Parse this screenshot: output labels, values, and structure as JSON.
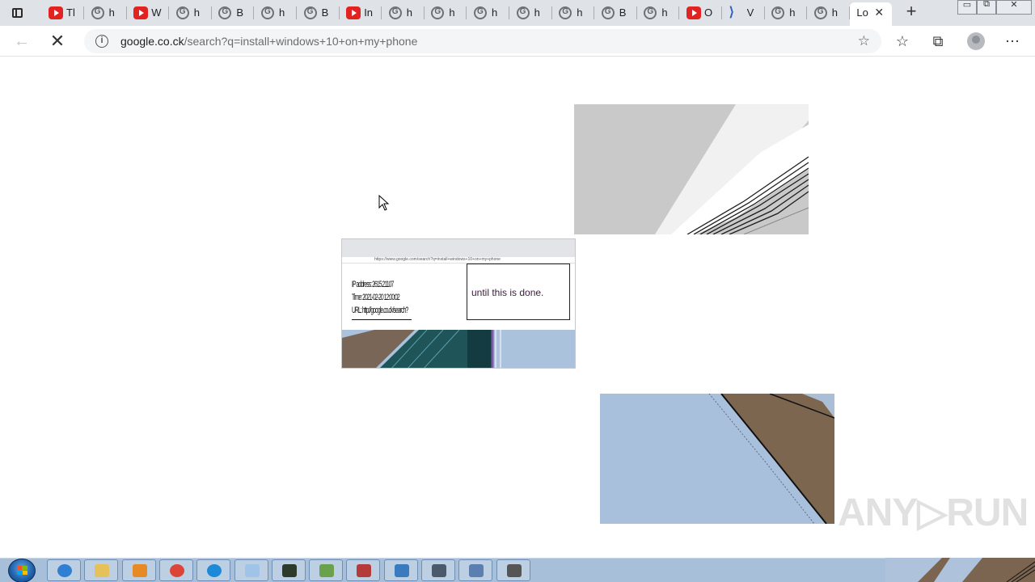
{
  "browser": {
    "tabs": [
      {
        "icon": "youtube-icon",
        "label": "Tl"
      },
      {
        "icon": "google-icon",
        "label": "h"
      },
      {
        "icon": "youtube-icon",
        "label": "W"
      },
      {
        "icon": "google-icon",
        "label": "h"
      },
      {
        "icon": "google-icon",
        "label": "B"
      },
      {
        "icon": "google-icon",
        "label": "h"
      },
      {
        "icon": "google-icon",
        "label": "B"
      },
      {
        "icon": "youtube-icon",
        "label": "In"
      },
      {
        "icon": "google-icon",
        "label": "h"
      },
      {
        "icon": "google-icon",
        "label": "h"
      },
      {
        "icon": "google-icon",
        "label": "h"
      },
      {
        "icon": "google-icon",
        "label": "h"
      },
      {
        "icon": "google-icon",
        "label": "h"
      },
      {
        "icon": "google-icon",
        "label": "B"
      },
      {
        "icon": "google-icon",
        "label": "h"
      },
      {
        "icon": "youtube-icon",
        "label": "O"
      },
      {
        "icon": "visual-studio-icon",
        "label": "V"
      },
      {
        "icon": "google-icon",
        "label": "h"
      },
      {
        "icon": "google-icon",
        "label": "h"
      },
      {
        "icon": "none",
        "label": "Lo",
        "active": true
      }
    ],
    "new_tab_glyph": "+",
    "close_tab_glyph": "✕",
    "window_controls": {
      "minimize": "▭",
      "restore": "⧉",
      "close": "✕"
    },
    "url_host": "google.co.ck",
    "url_path": "/search?q=install+windows+10+on+my+phone",
    "info_glyph": "i"
  },
  "page": {
    "mini_url": "https://www.google.com/search?q=install+windows+10+on+my+phone",
    "mini_info_lines": [
      "IP address: 2615.21107",
      "Time: 2021-02-20 12:00:02",
      "URL: http://google.co.ck/search?"
    ],
    "mini_box_text": "until this is done."
  },
  "watermark": "ANY▷RUN",
  "taskbar": {
    "items": [
      {
        "icon": "internet-explorer-icon",
        "color": "#2f7fd3"
      },
      {
        "icon": "file-explorer-icon",
        "color": "#e6c15a"
      },
      {
        "icon": "media-player-icon",
        "color": "#e58a24"
      },
      {
        "icon": "chrome-icon",
        "color": "#db4437"
      },
      {
        "icon": "edge-icon",
        "color": "#1c8ad8"
      },
      {
        "icon": "notepad-icon",
        "color": "#9fc4e8"
      },
      {
        "icon": "terminal-icon",
        "color": "#2d3b2d"
      },
      {
        "icon": "network-icon",
        "color": "#6aa14c"
      },
      {
        "icon": "toolbox-icon",
        "color": "#b53b3b"
      },
      {
        "icon": "remote-desktop-icon",
        "color": "#3a7bc0"
      },
      {
        "icon": "tool-icon",
        "color": "#4a5a6a"
      },
      {
        "icon": "document-icon",
        "color": "#5b7fb0"
      },
      {
        "icon": "calculator-icon",
        "color": "#555555"
      }
    ]
  }
}
